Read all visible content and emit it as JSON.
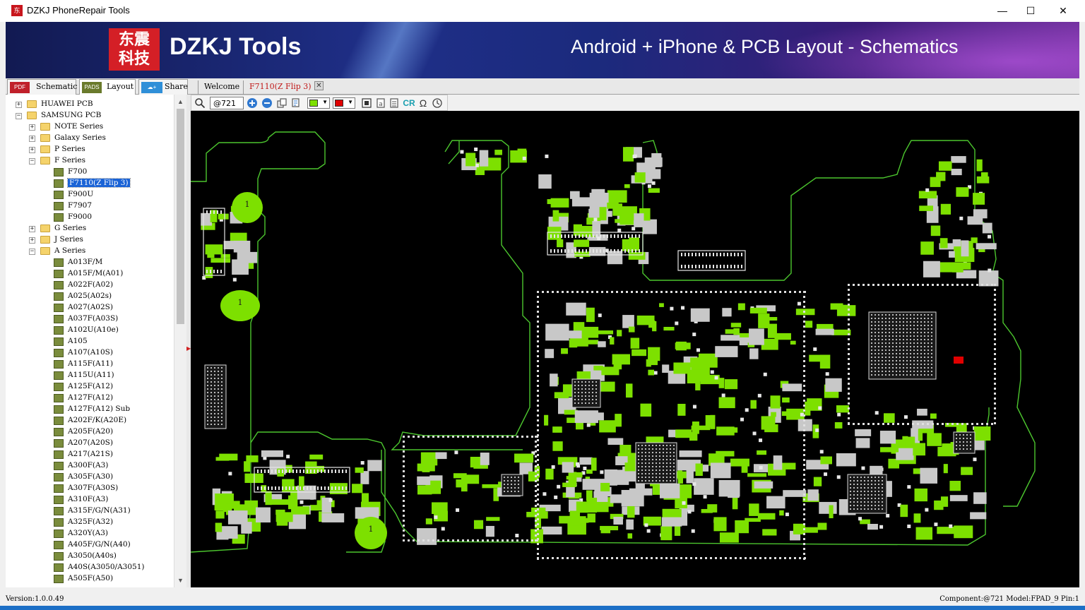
{
  "window": {
    "title": "DZKJ PhoneRepair Tools",
    "icon_text": "东震",
    "minimize": "—",
    "maximize": "☐",
    "close": "✕"
  },
  "banner": {
    "logo_text_line1": "东震",
    "logo_text_line2": "科技",
    "brand": "DZKJ Tools",
    "tagline": "Android + iPhone & PCB Layout - Schematics"
  },
  "mode_tabs": [
    {
      "icon": "PDF",
      "label": "Schematic",
      "active": false
    },
    {
      "icon": "PADS",
      "label": "Layout",
      "active": true
    },
    {
      "icon": "☁+",
      "label": "Share",
      "active": false
    }
  ],
  "doc_tabs": [
    {
      "label": "Welcome",
      "active": false
    },
    {
      "label": "F7110(Z Flip 3)",
      "active": true
    }
  ],
  "tree": {
    "rows": [
      {
        "label": "HUAWEI PCB",
        "depth": 0,
        "type": "folder",
        "expander": "+"
      },
      {
        "label": "SAMSUNG PCB",
        "depth": 0,
        "type": "folder",
        "expander": "−"
      },
      {
        "label": "NOTE Series",
        "depth": 1,
        "type": "folder",
        "expander": "+"
      },
      {
        "label": "Galaxy Series",
        "depth": 1,
        "type": "folder",
        "expander": "+"
      },
      {
        "label": "P Series",
        "depth": 1,
        "type": "folder",
        "expander": "+"
      },
      {
        "label": "F Series",
        "depth": 1,
        "type": "folder",
        "expander": "−"
      },
      {
        "label": "F700",
        "depth": 2,
        "type": "board"
      },
      {
        "label": "F7110(Z Flip 3)",
        "depth": 2,
        "type": "board",
        "selected": true
      },
      {
        "label": "F900U",
        "depth": 2,
        "type": "board"
      },
      {
        "label": "F7907",
        "depth": 2,
        "type": "board"
      },
      {
        "label": "F9000",
        "depth": 2,
        "type": "board"
      },
      {
        "label": "G Series",
        "depth": 1,
        "type": "folder",
        "expander": "+"
      },
      {
        "label": "J Series",
        "depth": 1,
        "type": "folder",
        "expander": "+"
      },
      {
        "label": "A Series",
        "depth": 1,
        "type": "folder",
        "expander": "−"
      },
      {
        "label": "A013F/M",
        "depth": 2,
        "type": "board"
      },
      {
        "label": "A015F/M(A01)",
        "depth": 2,
        "type": "board"
      },
      {
        "label": "A022F(A02)",
        "depth": 2,
        "type": "board"
      },
      {
        "label": "A025(A02s)",
        "depth": 2,
        "type": "board"
      },
      {
        "label": "A027(A02S)",
        "depth": 2,
        "type": "board"
      },
      {
        "label": "A037F(A03S)",
        "depth": 2,
        "type": "board"
      },
      {
        "label": "A102U(A10e)",
        "depth": 2,
        "type": "board"
      },
      {
        "label": "A105",
        "depth": 2,
        "type": "board"
      },
      {
        "label": "A107(A10S)",
        "depth": 2,
        "type": "board"
      },
      {
        "label": "A115F(A11)",
        "depth": 2,
        "type": "board"
      },
      {
        "label": "A115U(A11)",
        "depth": 2,
        "type": "board"
      },
      {
        "label": "A125F(A12)",
        "depth": 2,
        "type": "board"
      },
      {
        "label": "A127F(A12)",
        "depth": 2,
        "type": "board"
      },
      {
        "label": "A127F(A12) Sub",
        "depth": 2,
        "type": "board"
      },
      {
        "label": "A202F/K(A20E)",
        "depth": 2,
        "type": "board"
      },
      {
        "label": "A205F(A20)",
        "depth": 2,
        "type": "board"
      },
      {
        "label": "A207(A20S)",
        "depth": 2,
        "type": "board"
      },
      {
        "label": "A217(A21S)",
        "depth": 2,
        "type": "board"
      },
      {
        "label": "A300F(A3)",
        "depth": 2,
        "type": "board"
      },
      {
        "label": "A305F(A30)",
        "depth": 2,
        "type": "board"
      },
      {
        "label": "A307F(A30S)",
        "depth": 2,
        "type": "board"
      },
      {
        "label": "A310F(A3)",
        "depth": 2,
        "type": "board"
      },
      {
        "label": "A315F/G/N(A31)",
        "depth": 2,
        "type": "board"
      },
      {
        "label": "A325F(A32)",
        "depth": 2,
        "type": "board"
      },
      {
        "label": "A320Y(A3)",
        "depth": 2,
        "type": "board"
      },
      {
        "label": "A405F/G/N(A40)",
        "depth": 2,
        "type": "board"
      },
      {
        "label": "A3050(A40s)",
        "depth": 2,
        "type": "board"
      },
      {
        "label": "A40S(A3050/A3051)",
        "depth": 2,
        "type": "board"
      },
      {
        "label": "A505F(A50)",
        "depth": 2,
        "type": "board"
      }
    ]
  },
  "toolbar": {
    "search_value": "@721",
    "pad_color": "#7de000",
    "highlight_color": "#e00000",
    "cr_label": "CR",
    "omega_label": "Ω"
  },
  "pcb": {
    "board_outline_color": "#4cc62e",
    "pad_color": "#7de000",
    "marker_labels": [
      "1",
      "1",
      "1"
    ]
  },
  "status": {
    "version": "Version:1.0.0.49",
    "component_info": "Component:@721 Model:FPAD_9 Pin:1"
  },
  "icons": {
    "search": "magnifier-icon",
    "zoom_in": "zoom-in-icon",
    "zoom_out": "zoom-out-icon"
  }
}
